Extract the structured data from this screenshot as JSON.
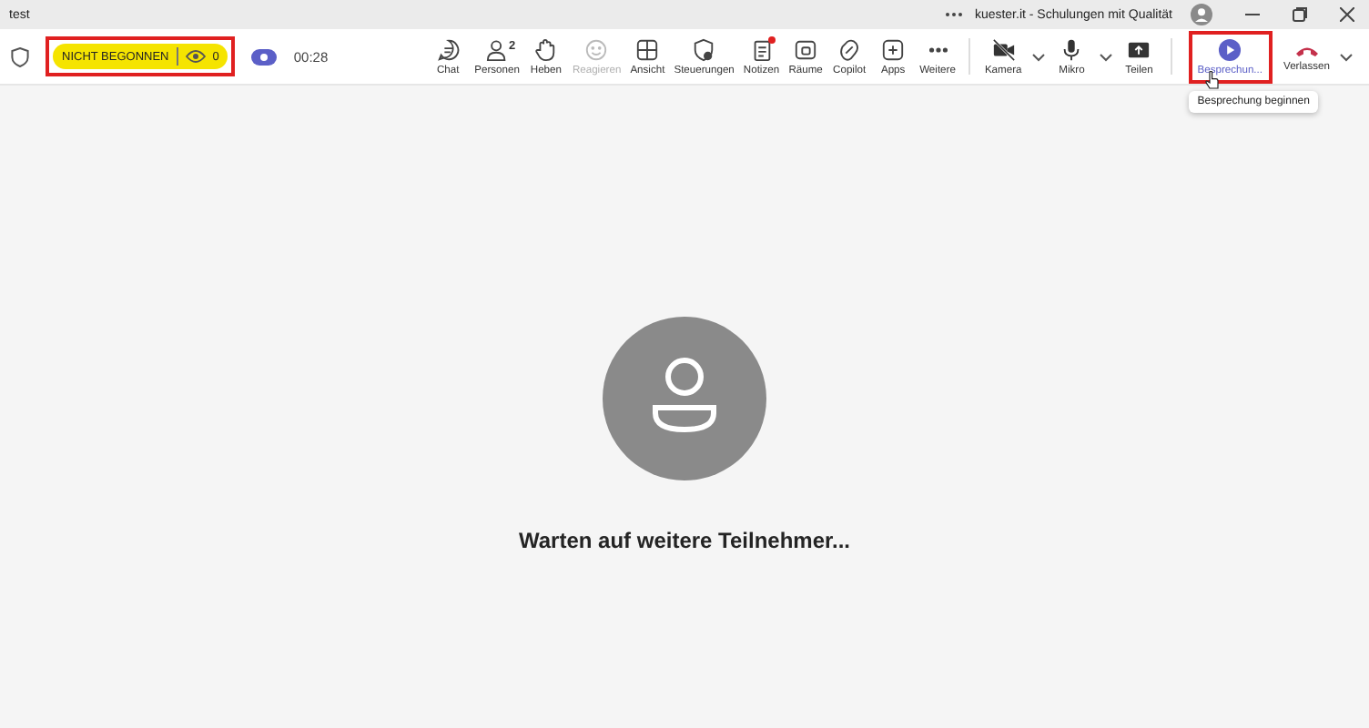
{
  "window": {
    "title": "test",
    "meeting_title": "kuester.it - Schulungen mit Qualität"
  },
  "status": {
    "label": "NICHT BEGONNEN",
    "viewers": "0",
    "highlighted": true
  },
  "timer": "00:28",
  "toolbar": [
    {
      "label": "Chat",
      "disabled": false
    },
    {
      "label": "Personen",
      "count": "2",
      "disabled": false
    },
    {
      "label": "Heben",
      "disabled": false
    },
    {
      "label": "Reagieren",
      "disabled": true
    },
    {
      "label": "Ansicht",
      "disabled": false
    },
    {
      "label": "Steuerungen",
      "disabled": false
    },
    {
      "label": "Notizen",
      "disabled": false,
      "badge": true
    },
    {
      "label": "Räume",
      "disabled": false
    },
    {
      "label": "Copilot",
      "disabled": false
    },
    {
      "label": "Apps",
      "disabled": false
    },
    {
      "label": "Weitere",
      "disabled": false
    }
  ],
  "devices": [
    {
      "label": "Kamera",
      "caret": true
    },
    {
      "label": "Mikro",
      "caret": true
    },
    {
      "label": "Teilen",
      "caret": false
    }
  ],
  "start_button": {
    "label": "Besprechun...",
    "highlighted": true,
    "tooltip": "Besprechung beginnen"
  },
  "leave_button": {
    "label": "Verlassen",
    "caret": true
  },
  "waiting_text": "Warten auf weitere Teilnehmer..."
}
